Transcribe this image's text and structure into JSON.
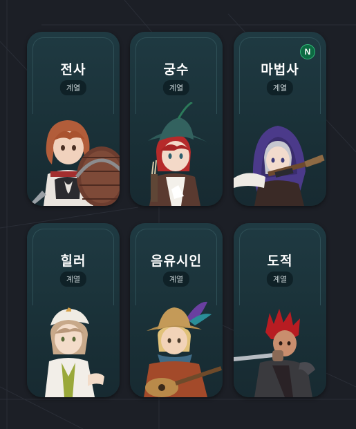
{
  "classes": [
    {
      "name": "전사",
      "tag": "계열",
      "new": "",
      "portrait": "warrior-portrait"
    },
    {
      "name": "궁수",
      "tag": "계열",
      "new": "",
      "portrait": "archer-portrait"
    },
    {
      "name": "마법사",
      "tag": "계열",
      "new": "N",
      "portrait": "mage-portrait"
    },
    {
      "name": "힐러",
      "tag": "계열",
      "new": "",
      "portrait": "healer-portrait"
    },
    {
      "name": "음유시인",
      "tag": "계열",
      "new": "",
      "portrait": "bard-portrait"
    },
    {
      "name": "도적",
      "tag": "계열",
      "new": "",
      "portrait": "rogue-portrait"
    }
  ],
  "colors": {
    "background": "#1c1f26",
    "card": "#1f3a42",
    "badge": "#0f2127",
    "new_badge": "#0c6b42"
  }
}
